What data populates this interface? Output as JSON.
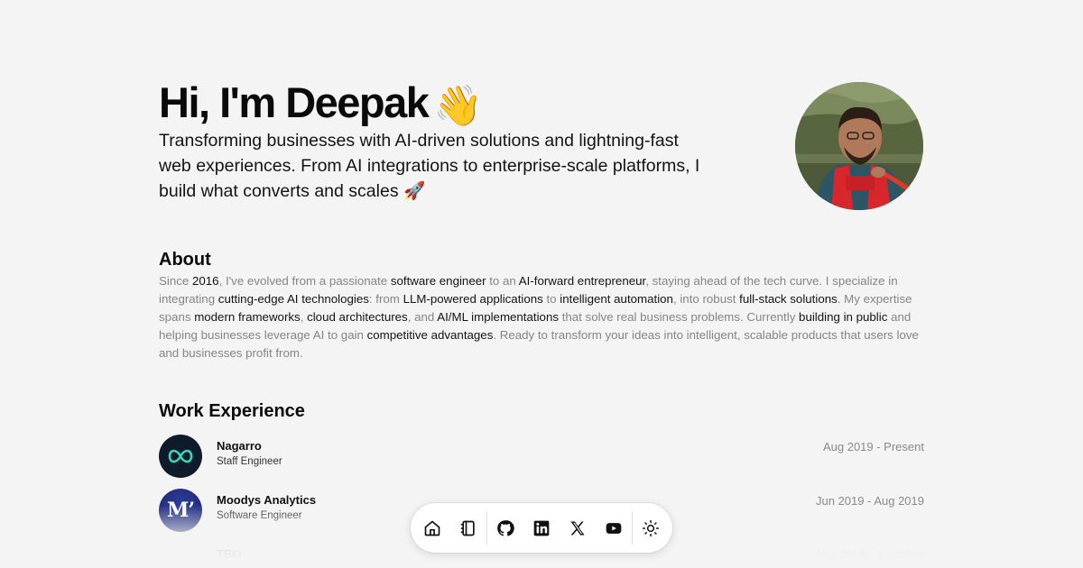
{
  "hero": {
    "title": "Hi, I'm Deepak",
    "title_emoji": "👋",
    "subtitle": "Transforming businesses with AI-driven solutions and lightning-fast web experiences. From AI integrations to enterprise-scale platforms, I build what converts and scales 🚀"
  },
  "about": {
    "title": "About",
    "segments": [
      {
        "text": "Since ",
        "strong": false
      },
      {
        "text": "2016",
        "strong": true
      },
      {
        "text": ", I've evolved from a passionate ",
        "strong": false
      },
      {
        "text": "software engineer",
        "strong": true
      },
      {
        "text": " to an ",
        "strong": false
      },
      {
        "text": "AI-forward entrepreneur",
        "strong": true
      },
      {
        "text": ", staying ahead of the tech curve. I specialize in integrating ",
        "strong": false
      },
      {
        "text": "cutting-edge AI technologies",
        "strong": true
      },
      {
        "text": ": from ",
        "strong": false
      },
      {
        "text": "LLM-powered applications",
        "strong": true
      },
      {
        "text": " to ",
        "strong": false
      },
      {
        "text": "intelligent automation",
        "strong": true
      },
      {
        "text": ", into robust ",
        "strong": false
      },
      {
        "text": "full-stack solutions",
        "strong": true
      },
      {
        "text": ". My expertise spans ",
        "strong": false
      },
      {
        "text": "modern frameworks",
        "strong": true
      },
      {
        "text": ", ",
        "strong": false
      },
      {
        "text": "cloud architectures",
        "strong": true
      },
      {
        "text": ", and ",
        "strong": false
      },
      {
        "text": "AI/ML implementations",
        "strong": true
      },
      {
        "text": " that solve real business problems. Currently ",
        "strong": false
      },
      {
        "text": "building in public",
        "strong": true
      },
      {
        "text": " and helping businesses leverage AI to gain ",
        "strong": false
      },
      {
        "text": "competitive advantages",
        "strong": true
      },
      {
        "text": ". Ready to transform your ideas into intelligent, scalable products that users love and businesses profit from.",
        "strong": false
      }
    ]
  },
  "work": {
    "title": "Work Experience",
    "jobs": [
      {
        "company": "Nagarro",
        "role": "Staff Engineer",
        "dates": "Aug 2019 - Present",
        "logo_icon": "nagarro-logo-icon"
      },
      {
        "company": "Moodys Analytics",
        "role": "Software Engineer",
        "dates": "Jun 2019 - Aug 2019",
        "logo_icon": "moodys-logo-icon",
        "logo_text": "M’"
      },
      {
        "company": "TBO",
        "role": "",
        "dates": "Mar 2018 - Jun 2019",
        "logo_icon": "tbo-logo-icon"
      }
    ]
  },
  "dock": {
    "items": [
      {
        "icon": "home-icon"
      },
      {
        "icon": "notebook-icon"
      },
      {
        "icon": "github-icon"
      },
      {
        "icon": "linkedin-icon"
      },
      {
        "icon": "x-icon"
      },
      {
        "icon": "youtube-icon"
      },
      {
        "icon": "sun-icon"
      }
    ]
  },
  "colors": {
    "background": "#f4f4f4",
    "text": "#0a0a0a",
    "muted": "#858585",
    "nagarro_bg": "#0d1b2a",
    "nagarro_accent": "#3ed3b5",
    "moodys_bg": "#1f2a7a"
  }
}
